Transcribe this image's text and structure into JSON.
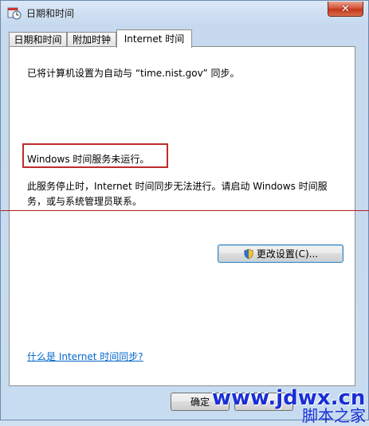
{
  "window": {
    "title": "日期和时间"
  },
  "tabs": [
    {
      "label": "日期和时间"
    },
    {
      "label": "附加时钟"
    },
    {
      "label": "Internet 时间"
    }
  ],
  "panel": {
    "sync_message": "已将计算机设置为自动与 “time.nist.gov” 同步。",
    "status_message": "Windows 时间服务未运行。",
    "description": "此服务停止时，Internet 时间同步无法进行。请启动 Windows 时间服务，或与系统管理员联系。",
    "change_settings_label": "更改设置(C)...",
    "help_link": "什么是 Internet 时间同步?"
  },
  "buttons": {
    "ok_label": "确定"
  },
  "watermark": {
    "url": "www.jdwx.cn",
    "site": "脚本之家"
  }
}
